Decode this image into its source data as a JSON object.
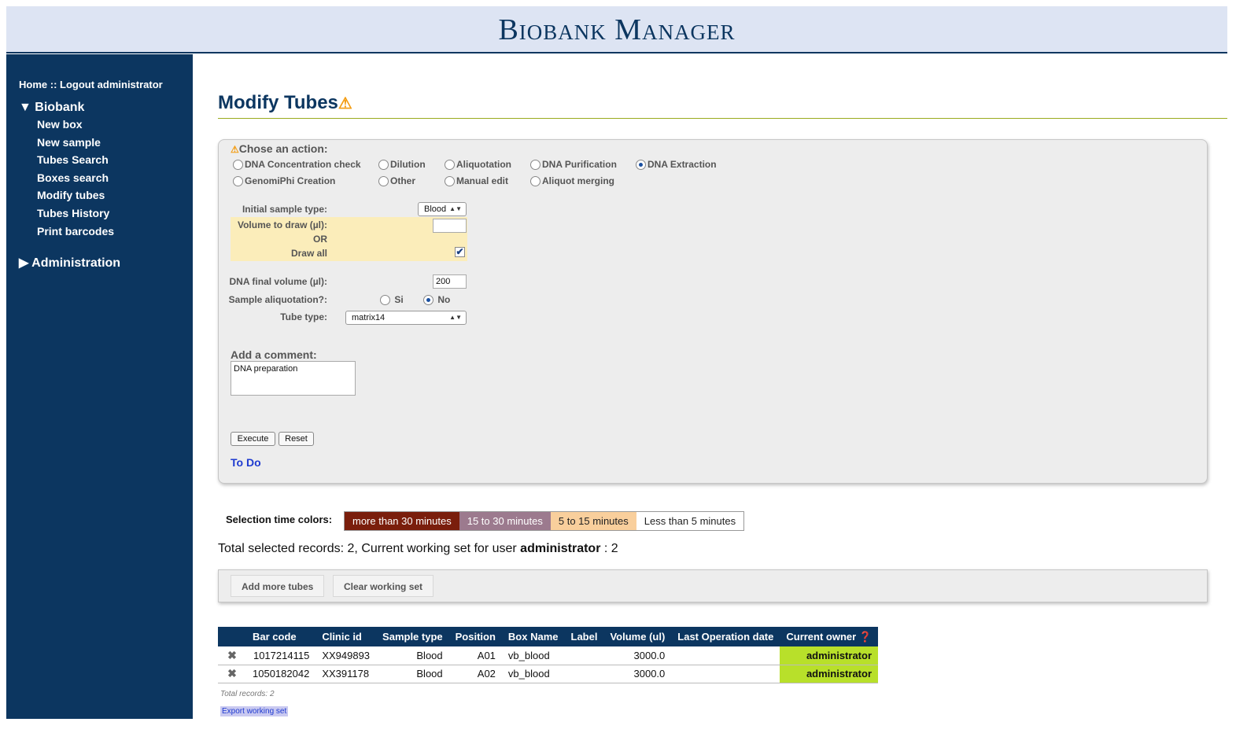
{
  "app": {
    "title": "Biobank Manager"
  },
  "nav": {
    "home": "Home",
    "sep": " :: ",
    "logout": "Logout administrator",
    "biobank_section": "Biobank",
    "items": [
      "New box",
      "New sample",
      "Tubes Search",
      "Boxes search",
      "Modify tubes",
      "Tubes History",
      "Print barcodes"
    ],
    "admin_section": "Administration"
  },
  "page": {
    "title": "Modify Tubes"
  },
  "form": {
    "chose_label": "Chose an action:",
    "actions": [
      {
        "label": "DNA Concentration check",
        "selected": false
      },
      {
        "label": "Dilution",
        "selected": false
      },
      {
        "label": "Aliquotation",
        "selected": false
      },
      {
        "label": "DNA Purification",
        "selected": false
      },
      {
        "label": "DNA Extraction",
        "selected": true
      },
      {
        "label": "GenomiPhi Creation",
        "selected": false
      },
      {
        "label": "Other",
        "selected": false
      },
      {
        "label": "Manual edit",
        "selected": false
      },
      {
        "label": "Aliquot merging",
        "selected": false
      }
    ],
    "initial_sample_type_label": "Initial sample type:",
    "initial_sample_type_value": "Blood",
    "volume_to_draw_label": "Volume to draw (µl):",
    "volume_to_draw_value": "",
    "or_label": "OR",
    "draw_all_label": "Draw all",
    "draw_all_checked": true,
    "dna_final_volume_label": "DNA final volume (µl):",
    "dna_final_volume_value": "200",
    "sample_aliquotation_label": "Sample aliquotation?:",
    "si_label": "Si",
    "no_label": "No",
    "aliquotation_selected": "No",
    "tube_type_label": "Tube type:",
    "tube_type_value": "matrix14",
    "comment_label": "Add a comment:",
    "comment_value": "DNA preparation",
    "execute_label": "Execute",
    "reset_label": "Reset",
    "todo_label": "To Do"
  },
  "legend": {
    "label": "Selection time colors:",
    "items": [
      {
        "label": "more than 30 minutes",
        "bg": "#7a1e0c",
        "fg": "#ffffff"
      },
      {
        "label": "15 to 30 minutes",
        "bg": "#9c7a8e",
        "fg": "#ffffff"
      },
      {
        "label": "5 to 15 minutes",
        "bg": "#f9cf9c",
        "fg": "#222222"
      },
      {
        "label": "Less than 5 minutes",
        "bg": "#ffffff",
        "fg": "#222222"
      }
    ]
  },
  "summary": {
    "prefix": "Total selected records: 2, Current working set for user ",
    "user": "administrator",
    "suffix": " : 2"
  },
  "toolbar": {
    "add_label": "Add more tubes",
    "clear_label": "Clear working set"
  },
  "table": {
    "columns": [
      "Bar code",
      "Clinic id",
      "Sample type",
      "Position",
      "Box Name",
      "Label",
      "Volume (ul)",
      "Last Operation date",
      "Current owner"
    ],
    "rows": [
      {
        "barcode": "1017214115",
        "clinic_id": "XX949893",
        "sample_type": "Blood",
        "position": "A01",
        "box_name": "vb_blood",
        "label": "",
        "volume": "3000.0",
        "last_op": "",
        "owner": "administrator"
      },
      {
        "barcode": "1050182042",
        "clinic_id": "XX391178",
        "sample_type": "Blood",
        "position": "A02",
        "box_name": "vb_blood",
        "label": "",
        "volume": "3000.0",
        "last_op": "",
        "owner": "administrator"
      }
    ],
    "total_records": "Total records: 2",
    "export_label": "Export working set"
  },
  "colors": {
    "navy": "#0c3660",
    "owner_green": "#b8e02a",
    "highlight": "#fbedba",
    "warn": "#f39c12"
  }
}
